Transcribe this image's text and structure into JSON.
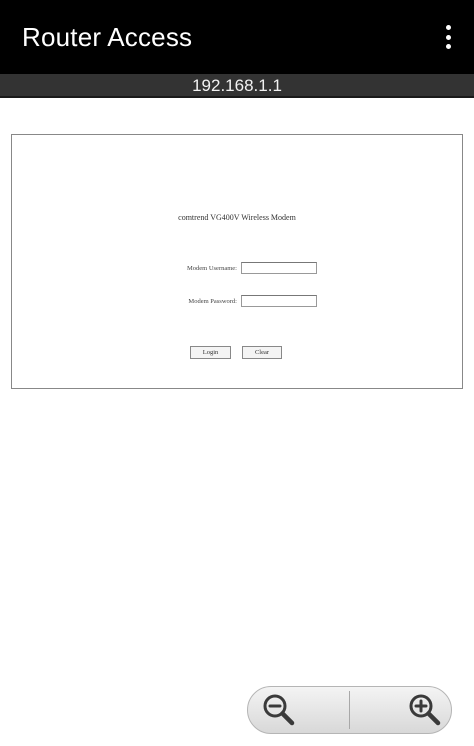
{
  "app": {
    "title": "Router Access",
    "menu_icon": "overflow-menu-icon"
  },
  "address": {
    "url": "192.168.1.1"
  },
  "login_page": {
    "title": "comtrend VG400V Wireless Modem",
    "username_label": "Modem Username:",
    "username_value": "",
    "password_label": "Modem Password:",
    "password_value": "",
    "login_button": "Login",
    "clear_button": "Clear"
  },
  "zoom": {
    "out_icon": "zoom-out-icon",
    "in_icon": "zoom-in-icon"
  },
  "colors": {
    "appbar": "#000000",
    "urlbar": "#333333",
    "background": "#ffffff"
  }
}
